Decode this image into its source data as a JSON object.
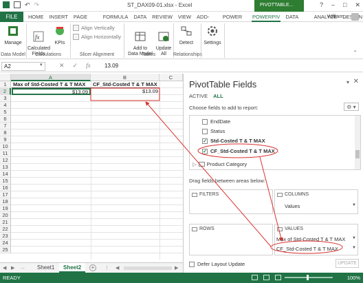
{
  "titlebar": {
    "title": "ST_DAX09-01.xlsx - Excel",
    "context_tab": "PIVOTTABLE...",
    "controls": [
      "?",
      "–",
      "□",
      "✕"
    ]
  },
  "ribbon_tabs": {
    "file": "FILE",
    "tabs": [
      "HOME",
      "INSERT",
      "PAGE LAY",
      "FORMULA",
      "DATA",
      "REVIEW",
      "VIEW",
      "ADD-INS",
      "POWER Q",
      "POWERPIV",
      "DATA MIN",
      "ANALYZE",
      "DESIGN"
    ],
    "active": "POWERPIV",
    "user": "William..."
  },
  "ribbon": {
    "manage": "Manage",
    "calc_fields": "Calculated\nFields",
    "kpis": "KPIs",
    "align_vertically": "Align Vertically",
    "align_horizontally": "Align Horizontally",
    "add_to_data_model": "Add to\nData Model",
    "update_all": "Update\nAll",
    "detect": "Detect",
    "settings": "Settings",
    "groups": [
      "Data Model",
      "Calculations",
      "Slicer Alignment",
      "Tables",
      "Relationships"
    ]
  },
  "formula_bar": {
    "name_box": "A2",
    "value": "13.09"
  },
  "grid": {
    "columns": [
      "A",
      "B",
      "C"
    ],
    "rows": [
      "1",
      "2",
      "3",
      "4",
      "5",
      "6",
      "7",
      "8",
      "9",
      "10",
      "11",
      "12",
      "13",
      "14",
      "15",
      "16",
      "17",
      "18",
      "19",
      "20",
      "21",
      "22",
      "23",
      "24",
      "25"
    ],
    "a1": "Max of Std-Costed T & T MAX",
    "b1": "CF_Std-Costed T & T MAX",
    "a2": "$13.09",
    "b2": "$13.09"
  },
  "sheets": {
    "nav": [
      "◀",
      "▶",
      "..."
    ],
    "tabs": [
      "Sheet1",
      "Sheet2"
    ],
    "active": "Sheet2"
  },
  "status": {
    "ready": "READY",
    "zoom": "100%"
  },
  "pivot": {
    "title": "PivotTable Fields",
    "tab_active": "ACTIVE",
    "tab_all": "ALL",
    "choose": "Choose fields to add to report:",
    "fields": [
      {
        "label": "EndDate",
        "checked": false
      },
      {
        "label": "Status",
        "checked": false
      },
      {
        "label": "Std-Costed T & T MAX",
        "checked": true
      },
      {
        "label": "CF_Std-Costed T & T MAX",
        "checked": true
      }
    ],
    "table": "Product Category",
    "drag": "Drag fields between areas below:",
    "filters": "FILTERS",
    "columns": "COLUMNS",
    "rows": "ROWS",
    "values": "VALUES",
    "columns_item": "Values",
    "values_items": [
      "Max of Std-Costed T & T MAX",
      "CF_Std-Costed T & T MAX"
    ],
    "defer": "Defer Layout Update",
    "update": "UPDATE"
  },
  "colors": {
    "accent": "#217346",
    "annotation": "#d9302c"
  }
}
